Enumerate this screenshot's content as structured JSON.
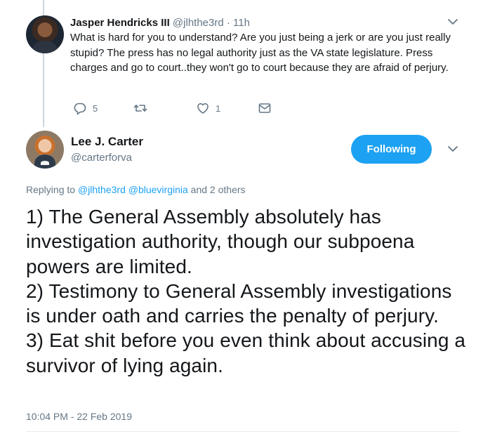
{
  "reply": {
    "name": "Jasper Hendricks III",
    "handle": "@jlhthe3rd",
    "separator": " · ",
    "time": "11h",
    "text": "What is hard for you to understand? Are you just being a jerk or are you just really stupid? The press has no legal authority just as the VA state legislature. Press charges and go to court..they won't go to court because they are afraid of perjury.",
    "actions": {
      "reply_count": "5",
      "retweet_count": "",
      "like_count": "1"
    }
  },
  "main": {
    "name": "Lee J. Carter",
    "handle": "@carterforva",
    "follow_label": "Following",
    "replying_prefix": "Replying to ",
    "replying_user1": "@jlhthe3rd",
    "replying_user2": "@bluevirginia",
    "replying_suffix": " and 2 others",
    "text_lines": [
      "1) The General Assembly absolutely has investigation authority, though our subpoena powers are limited.",
      "2) Testimony to General Assembly investigations is under oath and carries the penalty of perjury.",
      "3) Eat shit before you even think about accusing a survivor of lying again."
    ],
    "timestamp": "10:04 PM - 22 Feb 2019"
  },
  "colors": {
    "accent": "#1da1f2",
    "secondary_text": "#657786",
    "primary_text": "#14171a",
    "thread_line": "#ccd6dd"
  },
  "icons": [
    "reply-icon",
    "retweet-icon",
    "like-icon",
    "message-icon",
    "chevron-down-icon"
  ]
}
